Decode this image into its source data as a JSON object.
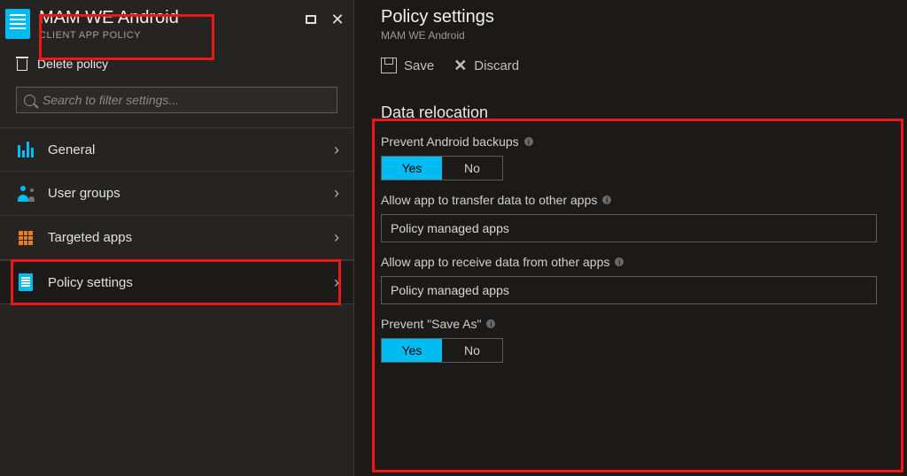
{
  "left": {
    "title": "MAM WE Android",
    "subtitle": "CLIENT APP POLICY",
    "delete_label": "Delete policy",
    "search_placeholder": "Search to filter settings...",
    "nav": [
      {
        "label": "General"
      },
      {
        "label": "User groups"
      },
      {
        "label": "Targeted apps"
      },
      {
        "label": "Policy settings"
      }
    ]
  },
  "right": {
    "title": "Policy settings",
    "subtitle": "MAM WE Android",
    "actions": {
      "save": "Save",
      "discard": "Discard"
    },
    "section_title": "Data relocation",
    "settings": {
      "prevent_backups": {
        "label": "Prevent Android backups",
        "yes": "Yes",
        "no": "No",
        "value": "Yes"
      },
      "transfer_data": {
        "label": "Allow app to transfer data to other apps",
        "value": "Policy managed apps"
      },
      "receive_data": {
        "label": "Allow app to receive data from other apps",
        "value": "Policy managed apps"
      },
      "prevent_save_as": {
        "label": "Prevent \"Save As\"",
        "yes": "Yes",
        "no": "No",
        "value": "Yes"
      }
    }
  },
  "colors": {
    "accent": "#00bcf2",
    "highlight": "#ef1616"
  }
}
